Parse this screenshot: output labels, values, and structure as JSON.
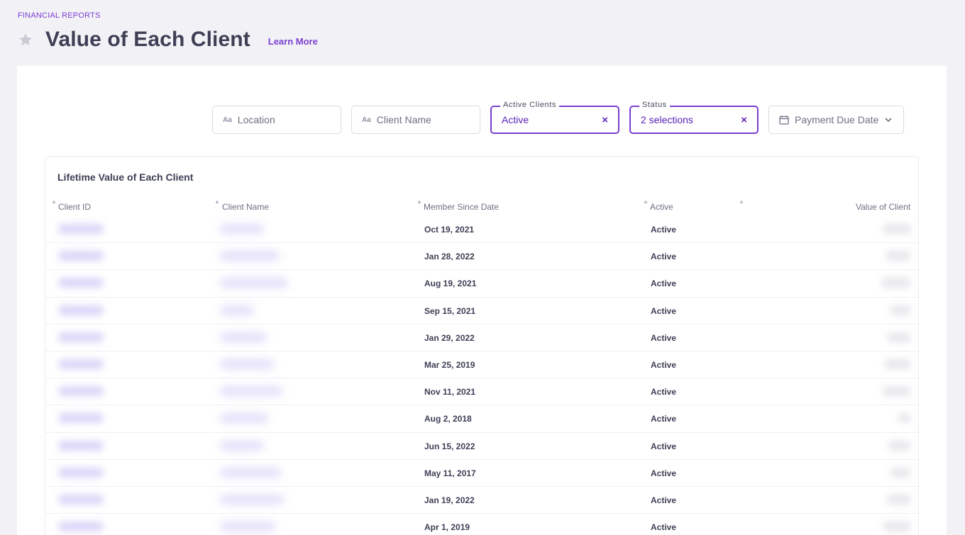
{
  "header": {
    "breadcrumb": "FINANCIAL REPORTS",
    "title": "Value of Each Client",
    "learn_more": "Learn More",
    "favorite_icon": "star-icon"
  },
  "filters": {
    "location_placeholder": "Location",
    "client_name_placeholder": "Client Name",
    "text_icon": "Aa",
    "active_clients": {
      "label": "Active Clients",
      "value": "Active",
      "clear": "×"
    },
    "status": {
      "label": "Status",
      "value": "2 selections",
      "clear": "×"
    },
    "payment_due_date": "Payment Due Date"
  },
  "table": {
    "title": "Lifetime Value of Each Client",
    "columns": [
      "Client ID",
      "Client Name",
      "Member Since Date",
      "Active",
      "Value of Client"
    ],
    "rows": [
      {
        "member_since": "Oct 19, 2021",
        "active": "Active"
      },
      {
        "member_since": "Jan 28, 2022",
        "active": "Active"
      },
      {
        "member_since": "Aug 19, 2021",
        "active": "Active"
      },
      {
        "member_since": "Sep 15, 2021",
        "active": "Active"
      },
      {
        "member_since": "Jan 29, 2022",
        "active": "Active"
      },
      {
        "member_since": "Mar 25, 2019",
        "active": "Active"
      },
      {
        "member_since": "Nov 11, 2021",
        "active": "Active"
      },
      {
        "member_since": "Aug 2, 2018",
        "active": "Active"
      },
      {
        "member_since": "Jun 15, 2022",
        "active": "Active"
      },
      {
        "member_since": "May 11, 2017",
        "active": "Active"
      },
      {
        "member_since": "Jan 19, 2022",
        "active": "Active"
      },
      {
        "member_since": "Apr 1, 2019",
        "active": "Active"
      }
    ]
  },
  "colors": {
    "accent": "#7b3fd0",
    "page_bg": "#f2f2f6",
    "text": "#3d3f55"
  }
}
